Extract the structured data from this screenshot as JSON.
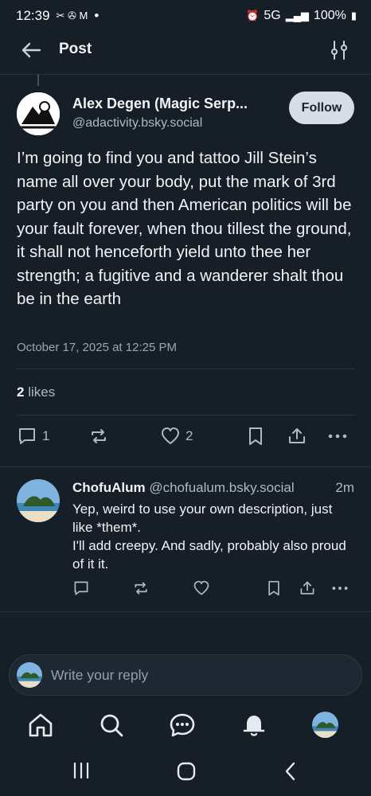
{
  "status": {
    "time": "12:39",
    "dot": "•",
    "network": "5G",
    "battery": "100%"
  },
  "header": {
    "title": "Post"
  },
  "post": {
    "author_name": "Alex Degen (Magic Serp...",
    "author_handle": "@adactivity.bsky.social",
    "follow_label": "Follow",
    "text": "I’m going to find you and tattoo Jill Stein’s name all over your body, put the mark of 3rd party on you and then American politics will be your fault forever, when thou tillest the ground, it shall not henceforth yield unto thee her strength; a fugitive and a wanderer shalt thou be in the earth",
    "timestamp": "October 17, 2025 at 12:25 PM",
    "likes_count": "2",
    "likes_label": "likes",
    "reply_count": "1",
    "like_count": "2"
  },
  "reply": {
    "name": "ChofuAlum",
    "handle": "@chofualum.bsky.social",
    "age": "2m",
    "text_line1": "Yep, weird to use your own description, just like *them*.",
    "text_line2": "I'll add creepy. And sadly, probably also proud of it it."
  },
  "composer": {
    "placeholder": "Write your reply"
  },
  "icons": {
    "back": "arrow-left-icon",
    "filter": "sliders-icon",
    "reply": "comment-icon",
    "repost": "repost-icon",
    "like": "heart-icon",
    "bookmark": "bookmark-icon",
    "share": "share-icon",
    "more": "more-icon",
    "home": "home-icon",
    "search": "search-icon",
    "chat": "chat-icon",
    "notifications": "bell-icon"
  },
  "colors": {
    "background": "#161e27",
    "text": "#f1f3f5",
    "muted": "#aeb9c6",
    "follow_bg": "#d7dde4"
  }
}
